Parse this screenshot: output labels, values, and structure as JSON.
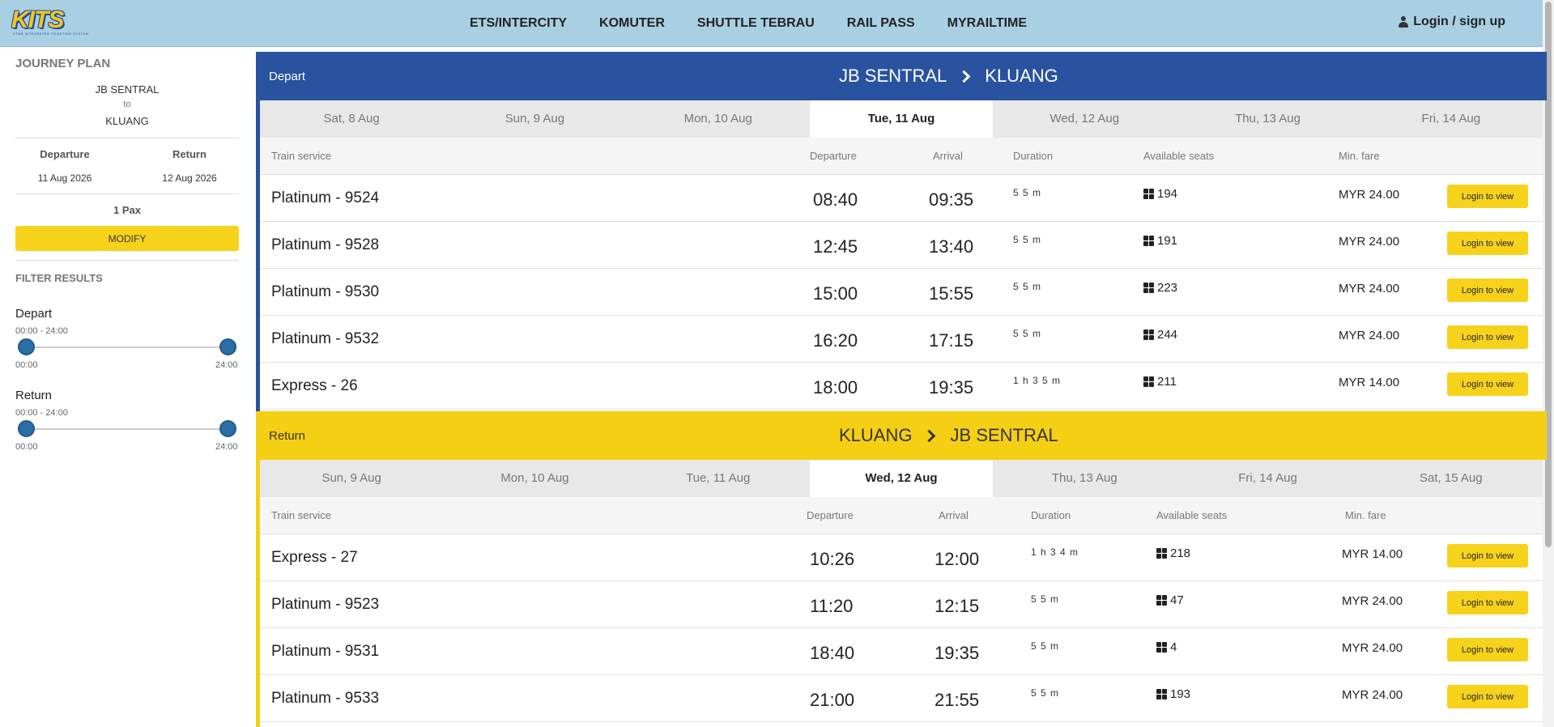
{
  "header": {
    "logo_text": "KITS",
    "logo_sub": "KTMB INTEGRATED TICKETING SYSTEM",
    "nav": [
      "ETS/INTERCITY",
      "KOMUTER",
      "SHUTTLE TEBRAU",
      "RAIL PASS",
      "MYRAILTIME"
    ],
    "login_label": "Login / sign up"
  },
  "sidebar": {
    "journey_title": "JOURNEY PLAN",
    "origin": "JB SENTRAL",
    "to_word": "to",
    "destination": "KLUANG",
    "departure_label": "Departure",
    "return_label": "Return",
    "departure_date": "11 Aug 2026",
    "return_date": "12 Aug 2026",
    "pax": "1 Pax",
    "modify_label": "MODIFY",
    "filter_title": "FILTER RESULTS",
    "depart_filter": {
      "label": "Depart",
      "range": "00:00 - 24:00",
      "min": "00:00",
      "max": "24:00"
    },
    "return_filter": {
      "label": "Return",
      "range": "00:00 - 24:00",
      "min": "00:00",
      "max": "24:00"
    }
  },
  "depart": {
    "label": "Depart",
    "from": "JB SENTRAL",
    "to": "KLUANG",
    "dates": [
      "Sat, 8 Aug",
      "Sun, 9 Aug",
      "Mon, 10 Aug",
      "Tue, 11 Aug",
      "Wed, 12 Aug",
      "Thu, 13 Aug",
      "Fri, 14 Aug"
    ],
    "active_date_index": 3,
    "columns": {
      "service": "Train service",
      "departure": "Departure",
      "arrival": "Arrival",
      "duration": "Duration",
      "seats": "Available seats",
      "fare": "Min. fare"
    },
    "rows": [
      {
        "service": "Platinum - 9524",
        "dep": "08:40",
        "arr": "09:35",
        "duration": "5 5 m",
        "seats": "194",
        "fare": "MYR 24.00",
        "action": "Login to view"
      },
      {
        "service": "Platinum - 9528",
        "dep": "12:45",
        "arr": "13:40",
        "duration": "5 5 m",
        "seats": "191",
        "fare": "MYR 24.00",
        "action": "Login to view"
      },
      {
        "service": "Platinum - 9530",
        "dep": "15:00",
        "arr": "15:55",
        "duration": "5 5 m",
        "seats": "223",
        "fare": "MYR 24.00",
        "action": "Login to view"
      },
      {
        "service": "Platinum - 9532",
        "dep": "16:20",
        "arr": "17:15",
        "duration": "5 5 m",
        "seats": "244",
        "fare": "MYR 24.00",
        "action": "Login to view"
      },
      {
        "service": "Express - 26",
        "dep": "18:00",
        "arr": "19:35",
        "duration": "1 h   3 5 m",
        "seats": "211",
        "fare": "MYR 14.00",
        "action": "Login to view"
      }
    ]
  },
  "return": {
    "label": "Return",
    "from": "KLUANG",
    "to": "JB SENTRAL",
    "dates": [
      "Sun, 9 Aug",
      "Mon, 10 Aug",
      "Tue, 11 Aug",
      "Wed, 12 Aug",
      "Thu, 13 Aug",
      "Fri, 14 Aug",
      "Sat, 15 Aug"
    ],
    "active_date_index": 3,
    "columns": {
      "service": "Train service",
      "departure": "Departure",
      "arrival": "Arrival",
      "duration": "Duration",
      "seats": "Available seats",
      "fare": "Min. fare"
    },
    "rows": [
      {
        "service": "Express - 27",
        "dep": "10:26",
        "arr": "12:00",
        "duration": "1 h   3 4 m",
        "seats": "218",
        "fare": "MYR 14.00",
        "action": "Login to view"
      },
      {
        "service": "Platinum - 9523",
        "dep": "11:20",
        "arr": "12:15",
        "duration": "5 5 m",
        "seats": "47",
        "fare": "MYR 24.00",
        "action": "Login to view"
      },
      {
        "service": "Platinum - 9531",
        "dep": "18:40",
        "arr": "19:35",
        "duration": "5 5 m",
        "seats": "4",
        "fare": "MYR 24.00",
        "action": "Login to view"
      },
      {
        "service": "Platinum - 9533",
        "dep": "21:00",
        "arr": "21:55",
        "duration": "5 5 m",
        "seats": "193",
        "fare": "MYR 24.00",
        "action": "Login to view"
      }
    ]
  }
}
